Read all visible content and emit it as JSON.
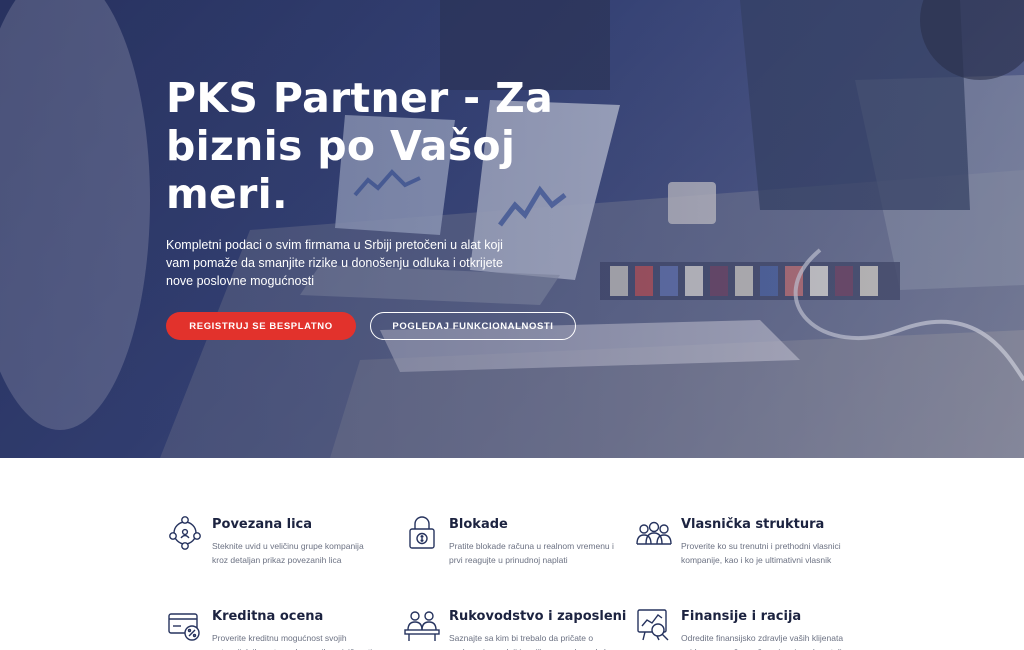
{
  "hero": {
    "title": "PKS Partner - Za biznis po Vašoj meri.",
    "subtitle": "Kompletni podaci o svim firmama u Srbiji pretočeni u alat koji vam pomaže da smanjite rizike u donošenju odluka i otkrijete nove poslovne mogućnosti",
    "primary_button": "REGISTRUJ SE BESPLATNO",
    "secondary_button": "POGLEDAJ FUNKCIONALNOSTI"
  },
  "features": [
    {
      "icon": "network-people-icon",
      "title": "Povezana lica",
      "text": "Steknite uvid u veličinu grupe kompanija kroz detaljan prikaz povezanih lica"
    },
    {
      "icon": "lock-money-icon",
      "title": "Blokade",
      "text": "Pratite blokade računa u realnom vremenu i prvi reagujte u prinudnoj naplati"
    },
    {
      "icon": "ownership-group-icon",
      "title": "Vlasnička struktura",
      "text": "Proverite ko su trenutni i prethodni vlasnici kompanije, kao i ko je ultimativni vlasnik"
    },
    {
      "icon": "credit-card-percent-icon",
      "title": "Kreditna ocena",
      "text": "Proverite kreditnu mogućnost svojih potencijalnih partnera kroz prikaz rizičnosti"
    },
    {
      "icon": "management-team-icon",
      "title": "Rukovodstvo i zaposleni",
      "text": "Saznajte sa kim bi trebalo da pričate o poslovnoj saradnji i o njihovom rukovodećem"
    },
    {
      "icon": "finance-chart-icon",
      "title": "Finansije i racija",
      "text": "Odredite finansijsko zdravlje vaših klijenata uvidom u završne račune i racio pokazatelje"
    }
  ],
  "colors": {
    "accent": "#e2322c",
    "icon": "#26335e",
    "heading": "#1c2340"
  }
}
